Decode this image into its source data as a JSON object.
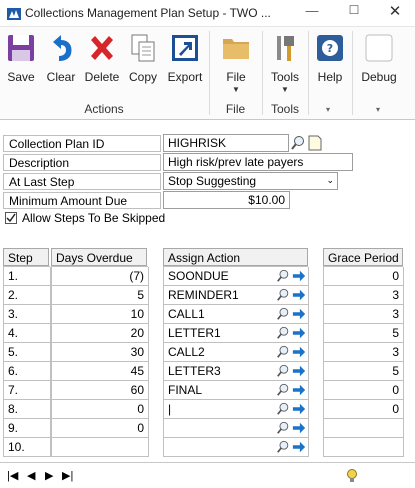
{
  "window": {
    "title": "Collections Management Plan Setup  -  TWO ..."
  },
  "ribbon": {
    "actions": [
      {
        "label": "Save",
        "icon": "save-icon"
      },
      {
        "label": "Clear",
        "icon": "undo-icon"
      },
      {
        "label": "Delete",
        "icon": "delete-x-icon"
      },
      {
        "label": "Copy",
        "icon": "copy-icon"
      },
      {
        "label": "Export",
        "icon": "export-icon"
      }
    ],
    "actions_group": "Actions",
    "file_label": "File",
    "file_group": "File",
    "tools_label": "Tools",
    "tools_group": "Tools",
    "help_label": "Help",
    "debug_label": "Debug"
  },
  "form": {
    "plan_id_label": "Collection Plan ID",
    "plan_id_value": "HIGHRISK",
    "description_label": "Description",
    "description_value": "High risk/prev late payers",
    "last_step_label": "At Last Step",
    "last_step_value": "Stop Suggesting",
    "min_amount_label": "Minimum Amount Due",
    "min_amount_value": "$10.00",
    "allow_skip_label": "Allow Steps To Be Skipped",
    "allow_skip_checked": true
  },
  "grid": {
    "headers": {
      "step": "Step",
      "days": "Days Overdue",
      "action": "Assign Action",
      "grace": "Grace Period"
    },
    "rows": [
      {
        "step": "1.",
        "days": "(7)",
        "action": "SOONDUE",
        "grace": "0"
      },
      {
        "step": "2.",
        "days": "5",
        "action": "REMINDER1",
        "grace": "3"
      },
      {
        "step": "3.",
        "days": "10",
        "action": "CALL1",
        "grace": "3"
      },
      {
        "step": "4.",
        "days": "20",
        "action": "LETTER1",
        "grace": "5"
      },
      {
        "step": "5.",
        "days": "30",
        "action": "CALL2",
        "grace": "3"
      },
      {
        "step": "6.",
        "days": "45",
        "action": "LETTER3",
        "grace": "5"
      },
      {
        "step": "7.",
        "days": "60",
        "action": "FINAL",
        "grace": "0"
      },
      {
        "step": "8.",
        "days": "0",
        "action": "|",
        "grace": "0"
      },
      {
        "step": "9.",
        "days": "0",
        "action": "",
        "grace": ""
      },
      {
        "step": "10.",
        "days": "",
        "action": "",
        "grace": ""
      }
    ]
  },
  "nav": {
    "first": "|◀",
    "prev": "◀",
    "next": "▶",
    "last": "▶|"
  }
}
